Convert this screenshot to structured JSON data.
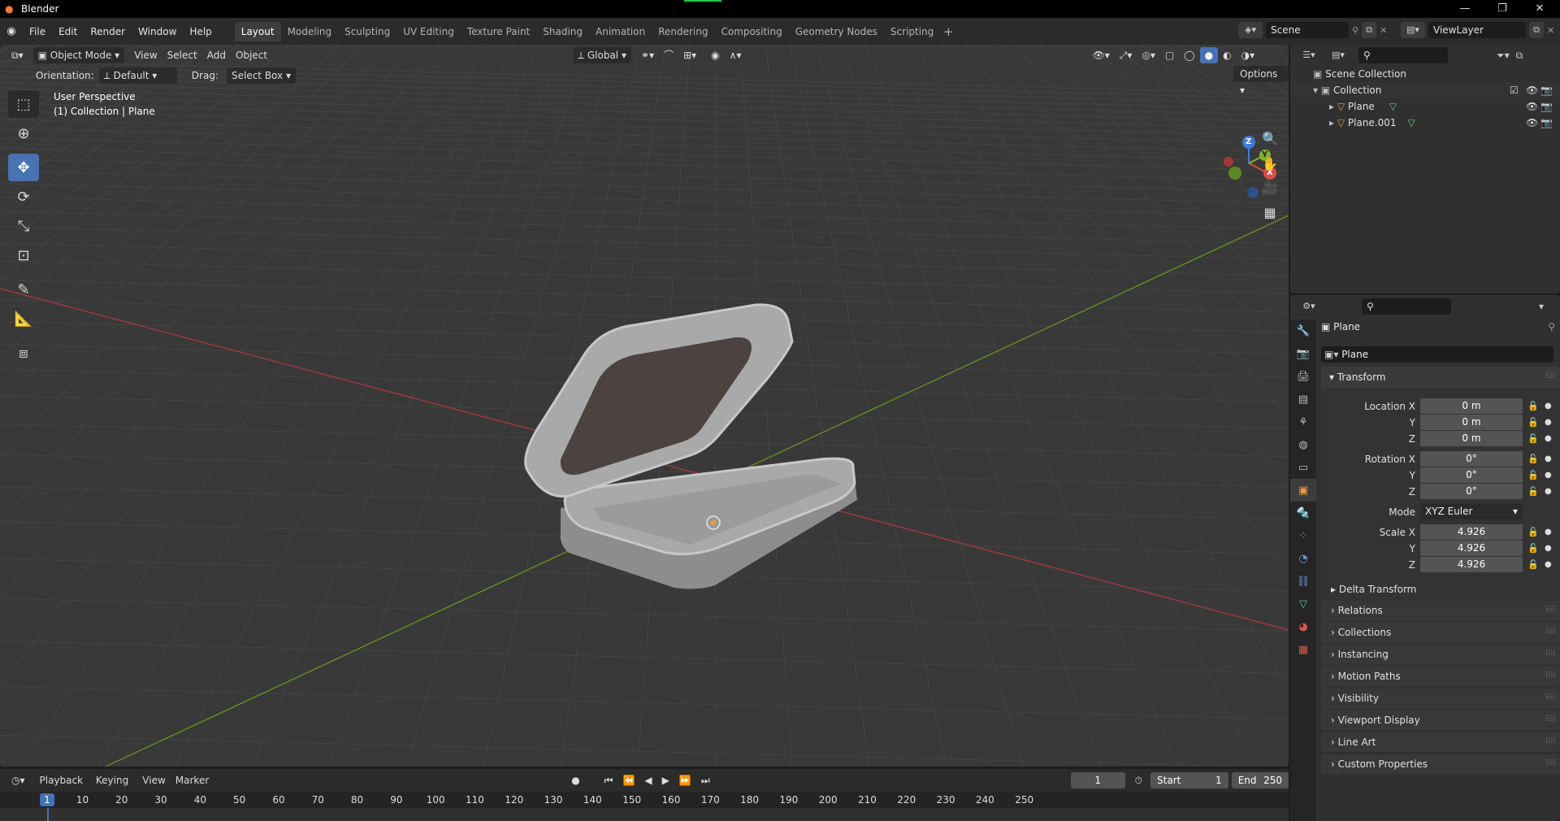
{
  "window": {
    "title": "Blender"
  },
  "menubar": {
    "menus": [
      "File",
      "Edit",
      "Render",
      "Window",
      "Help"
    ],
    "workspaces": [
      "Layout",
      "Modeling",
      "Sculpting",
      "UV Editing",
      "Texture Paint",
      "Shading",
      "Animation",
      "Rendering",
      "Compositing",
      "Geometry Nodes",
      "Scripting"
    ],
    "active_workspace": "Layout",
    "scene": "Scene",
    "view_layer": "ViewLayer"
  },
  "viewport": {
    "mode": "Object Mode",
    "menus": [
      "View",
      "Select",
      "Add",
      "Object"
    ],
    "transform_orientation": "Global",
    "orientation_label": "Orientation:",
    "orientation_value": "Default",
    "drag_label": "Drag:",
    "drag_value": "Select Box",
    "options_label": "Options",
    "info_line1": "User Perspective",
    "info_line2": "(1) Collection | Plane",
    "gizmo": {
      "x": "X",
      "y": "Y",
      "z": "Z"
    }
  },
  "timeline": {
    "menus": [
      "Playback",
      "Keying",
      "View",
      "Marker"
    ],
    "current_frame": "1",
    "start_label": "Start",
    "start": "1",
    "end_label": "End",
    "end": "250",
    "ruler_ticks": [
      "10",
      "20",
      "30",
      "40",
      "50",
      "60",
      "70",
      "80",
      "90",
      "100",
      "110",
      "120",
      "130",
      "140",
      "150",
      "160",
      "170",
      "180",
      "190",
      "200",
      "210",
      "220",
      "230",
      "240",
      "250"
    ],
    "ruler_current": "1"
  },
  "outliner": {
    "scene_collection": "Scene Collection",
    "collection": "Collection",
    "objects": [
      "Plane",
      "Plane.001"
    ]
  },
  "properties": {
    "object_name": "Plane",
    "datablock_name": "Plane",
    "transform_title": "Transform",
    "location": {
      "label": "Location X",
      "x": "0 m",
      "y": "0 m",
      "z": "0 m"
    },
    "rotation": {
      "label": "Rotation X",
      "x": "0°",
      "y": "0°",
      "z": "0°"
    },
    "mode_label": "Mode",
    "mode_value": "XYZ Euler",
    "scale": {
      "label": "Scale X",
      "x": "4.926",
      "y": "4.926",
      "z": "4.926"
    },
    "axis_y": "Y",
    "axis_z": "Z",
    "delta_transform": "Delta Transform",
    "panels": [
      "Relations",
      "Collections",
      "Instancing",
      "Motion Paths",
      "Visibility",
      "Viewport Display",
      "Line Art",
      "Custom Properties"
    ]
  },
  "colors": {
    "accent": "#4772b3",
    "x_axis": "#d94a4a",
    "y_axis": "#7fb32d",
    "z_axis": "#3f7ad9"
  }
}
